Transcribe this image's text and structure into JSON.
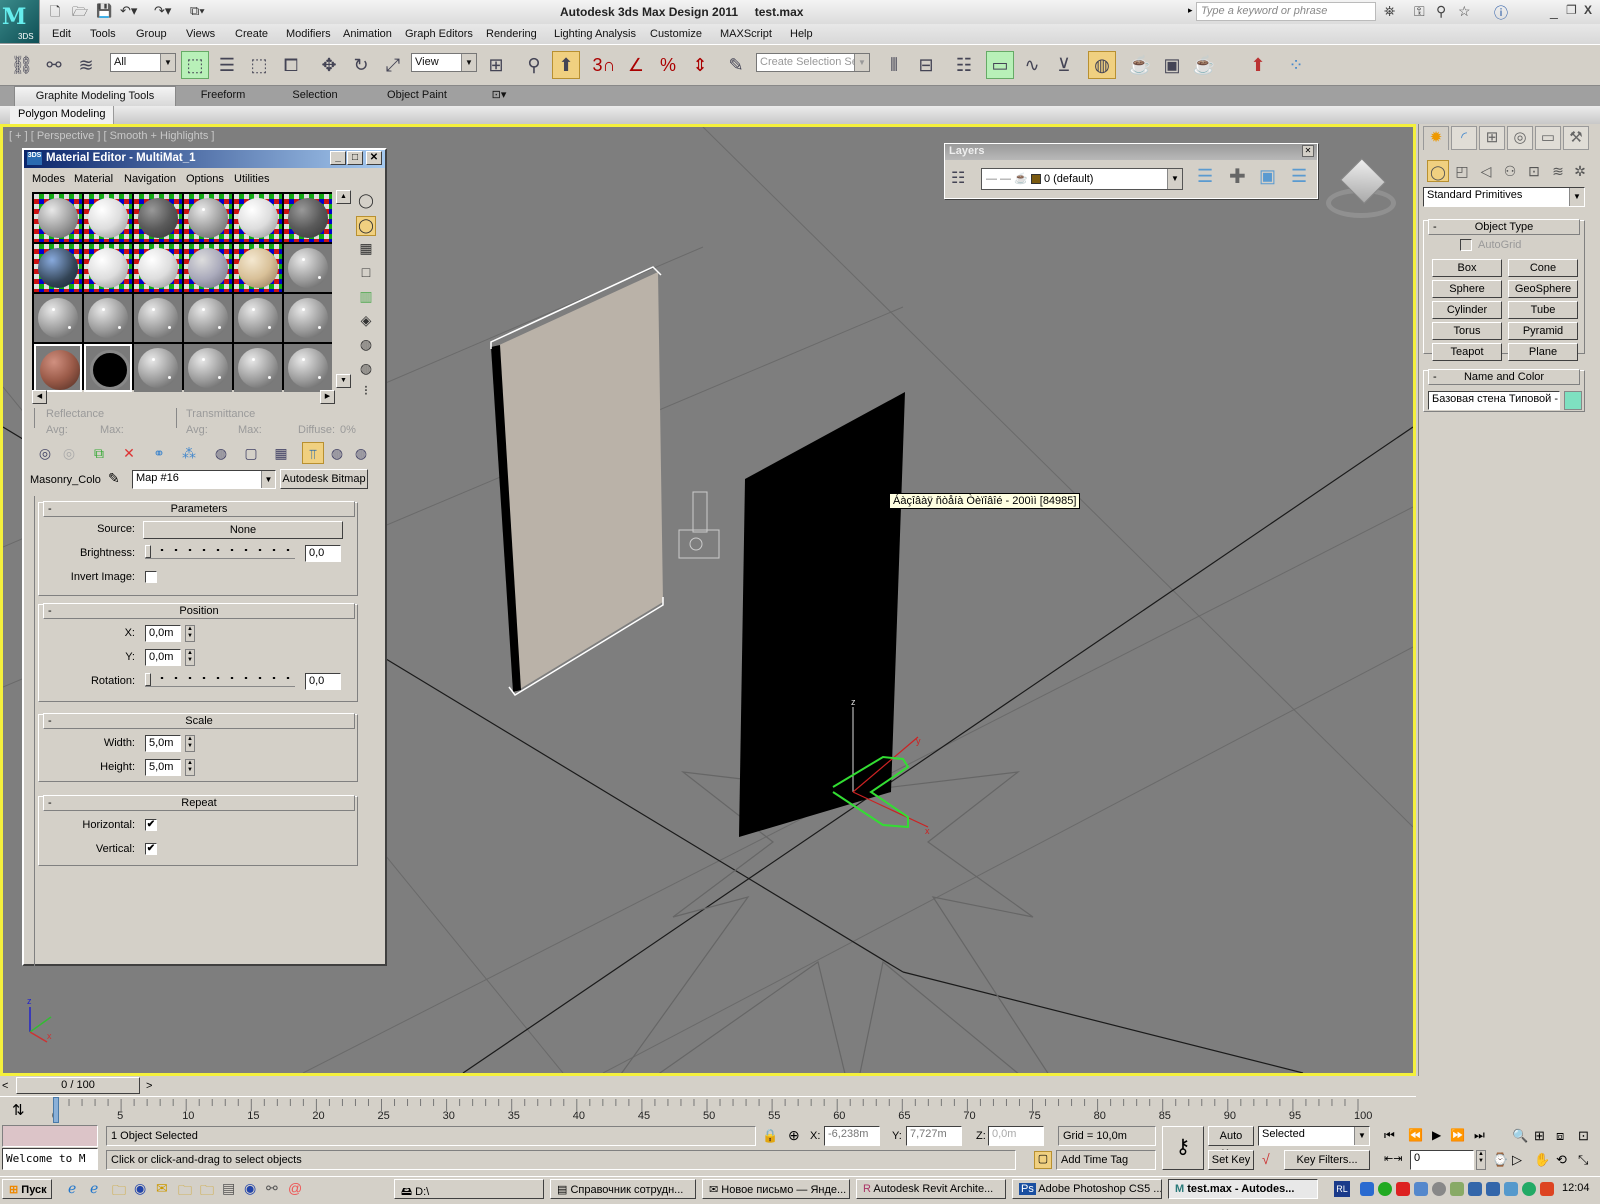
{
  "titlebar": {
    "app_title": "Autodesk 3ds Max Design 2011",
    "file_name": "test.max",
    "logo_text": "3DS",
    "search_placeholder": "Type a keyword or phrase"
  },
  "menu": [
    "Edit",
    "Tools",
    "Group",
    "Views",
    "Create",
    "Modifiers",
    "Animation",
    "Graph Editors",
    "Rendering",
    "Lighting Analysis",
    "Customize",
    "MAXScript",
    "Help"
  ],
  "toolbar": {
    "selection_filter": "All",
    "ref_coord": "View",
    "named_selection_placeholder": "Create Selection Se",
    "snap_angle_label": "3"
  },
  "ribbon": {
    "tabs": [
      "Graphite Modeling Tools",
      "Freeform",
      "Selection",
      "Object Paint"
    ],
    "active_tab": "Graphite Modeling Tools",
    "panel": "Polygon Modeling"
  },
  "viewport": {
    "label": "[ + ] [ Perspective ] [ Smooth + Highlights ]",
    "tooltip": "Áàçîâàÿ ñòåíà Òèïîâîé - 200ìì [84985]",
    "axis": {
      "x": "x",
      "y": "y",
      "z": "z"
    },
    "colors": {
      "border": "#f4f03c",
      "background": "#7e7e7e",
      "wall1": "#bab2a8",
      "wall2": "#000000",
      "gizmo": "#33dd33",
      "axis": "#cc2222"
    }
  },
  "material_editor": {
    "title": "Material Editor - MultiMat_1",
    "menu": [
      "Modes",
      "Material",
      "Navigation",
      "Options",
      "Utilities"
    ],
    "reflectance": {
      "label": "Reflectance",
      "avg": "Avg:",
      "max": "Max:"
    },
    "transmittance": {
      "label": "Transmittance",
      "avg": "Avg:",
      "max": "Max:",
      "diffuse": "Diffuse:",
      "diffuse_val": "0%"
    },
    "map_slot_label": "Masonry_Colo",
    "map_name": "Map #16",
    "map_type": "Autodesk Bitmap",
    "parameters": {
      "title": "Parameters",
      "source_label": "Source:",
      "source_value": "None",
      "brightness_label": "Brightness:",
      "brightness_value": "0,0",
      "invert_label": "Invert Image:",
      "invert_checked": false
    },
    "position": {
      "title": "Position",
      "x_label": "X:",
      "x_value": "0,0m",
      "y_label": "Y:",
      "y_value": "0,0m",
      "rotation_label": "Rotation:",
      "rotation_value": "0,0"
    },
    "scale": {
      "title": "Scale",
      "width_label": "Width:",
      "width_value": "5,0m",
      "height_label": "Height:",
      "height_value": "5,0m"
    },
    "repeat": {
      "title": "Repeat",
      "horizontal_label": "Horizontal:",
      "horizontal_checked": true,
      "vertical_label": "Vertical:",
      "vertical_checked": true
    }
  },
  "layers": {
    "title": "Layers",
    "current_layer": "0 (default)",
    "layer_color": "#7a5a10"
  },
  "command_panel": {
    "category": "Standard Primitives",
    "object_type_title": "Object Type",
    "autogrid": "AutoGrid",
    "buttons": [
      "Box",
      "Cone",
      "Sphere",
      "GeoSphere",
      "Cylinder",
      "Tube",
      "Torus",
      "Pyramid",
      "Teapot",
      "Plane"
    ],
    "name_color_title": "Name and Color",
    "object_name": "Базовая стена Типовой -",
    "object_color": "#7ee0c0"
  },
  "timeline": {
    "frame_display": "0 / 100",
    "ticks": [
      "0",
      "5",
      "10",
      "15",
      "20",
      "25",
      "30",
      "35",
      "40",
      "45",
      "50",
      "55",
      "60",
      "65",
      "70",
      "75",
      "80",
      "85",
      "90",
      "95",
      "100"
    ],
    "current_frame": 0
  },
  "status": {
    "selection": "1 Object Selected",
    "prompt": "Click or click-and-drag to select objects",
    "maxscript_listener": "Welcome to M",
    "x_label": "X:",
    "x": "-6,238m",
    "y_label": "Y:",
    "y": "7,727m",
    "z_label": "Z:",
    "z": "0,0m",
    "grid": "Grid = 10,0m",
    "add_time_tag": "Add Time Tag",
    "auto_key": "Auto Key",
    "set_key": "Set Key",
    "key_mode": "Selected",
    "key_filters": "Key Filters...",
    "frame_field": "0"
  },
  "taskbar": {
    "start": "Пуск",
    "tasks": [
      "D:\\",
      "Справочник сотрудн...",
      "Новое письмо — Янде...",
      "Autodesk Revit Archite...",
      "Adobe Photoshop CS5 ...",
      "test.max - Autodes..."
    ],
    "active_task": 5,
    "lang": "RL",
    "clock": "12:04"
  }
}
